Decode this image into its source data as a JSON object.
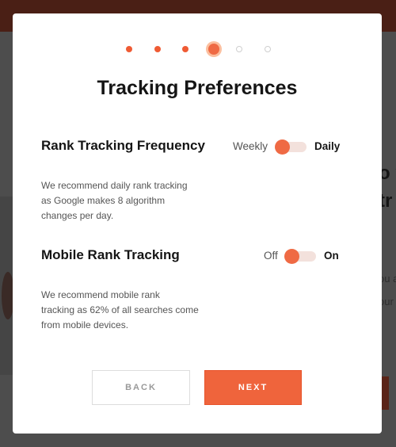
{
  "background": {
    "fragments": [
      "o y",
      "tr",
      "ou a",
      "our"
    ]
  },
  "modal": {
    "steps": [
      {
        "state": "done"
      },
      {
        "state": "done"
      },
      {
        "state": "done"
      },
      {
        "state": "active"
      },
      {
        "state": "todo"
      },
      {
        "state": "todo"
      }
    ],
    "title": "Tracking Preferences",
    "frequency": {
      "heading": "Rank Tracking Frequency",
      "off_label": "Weekly",
      "on_label": "Daily",
      "description": [
        "We recommend daily rank tracking",
        "as Google makes 8 algorithm",
        "changes per day."
      ]
    },
    "mobile": {
      "heading": "Mobile Rank Tracking",
      "off_label": "Off",
      "on_label": "On",
      "description": [
        "We recommend mobile rank",
        "tracking as 62% of all searches come",
        "from mobile devices."
      ]
    },
    "back_label": "BACK",
    "next_label": "NEXT"
  },
  "colors": {
    "accent": "#ef643c",
    "topbar": "#4a1f15"
  }
}
